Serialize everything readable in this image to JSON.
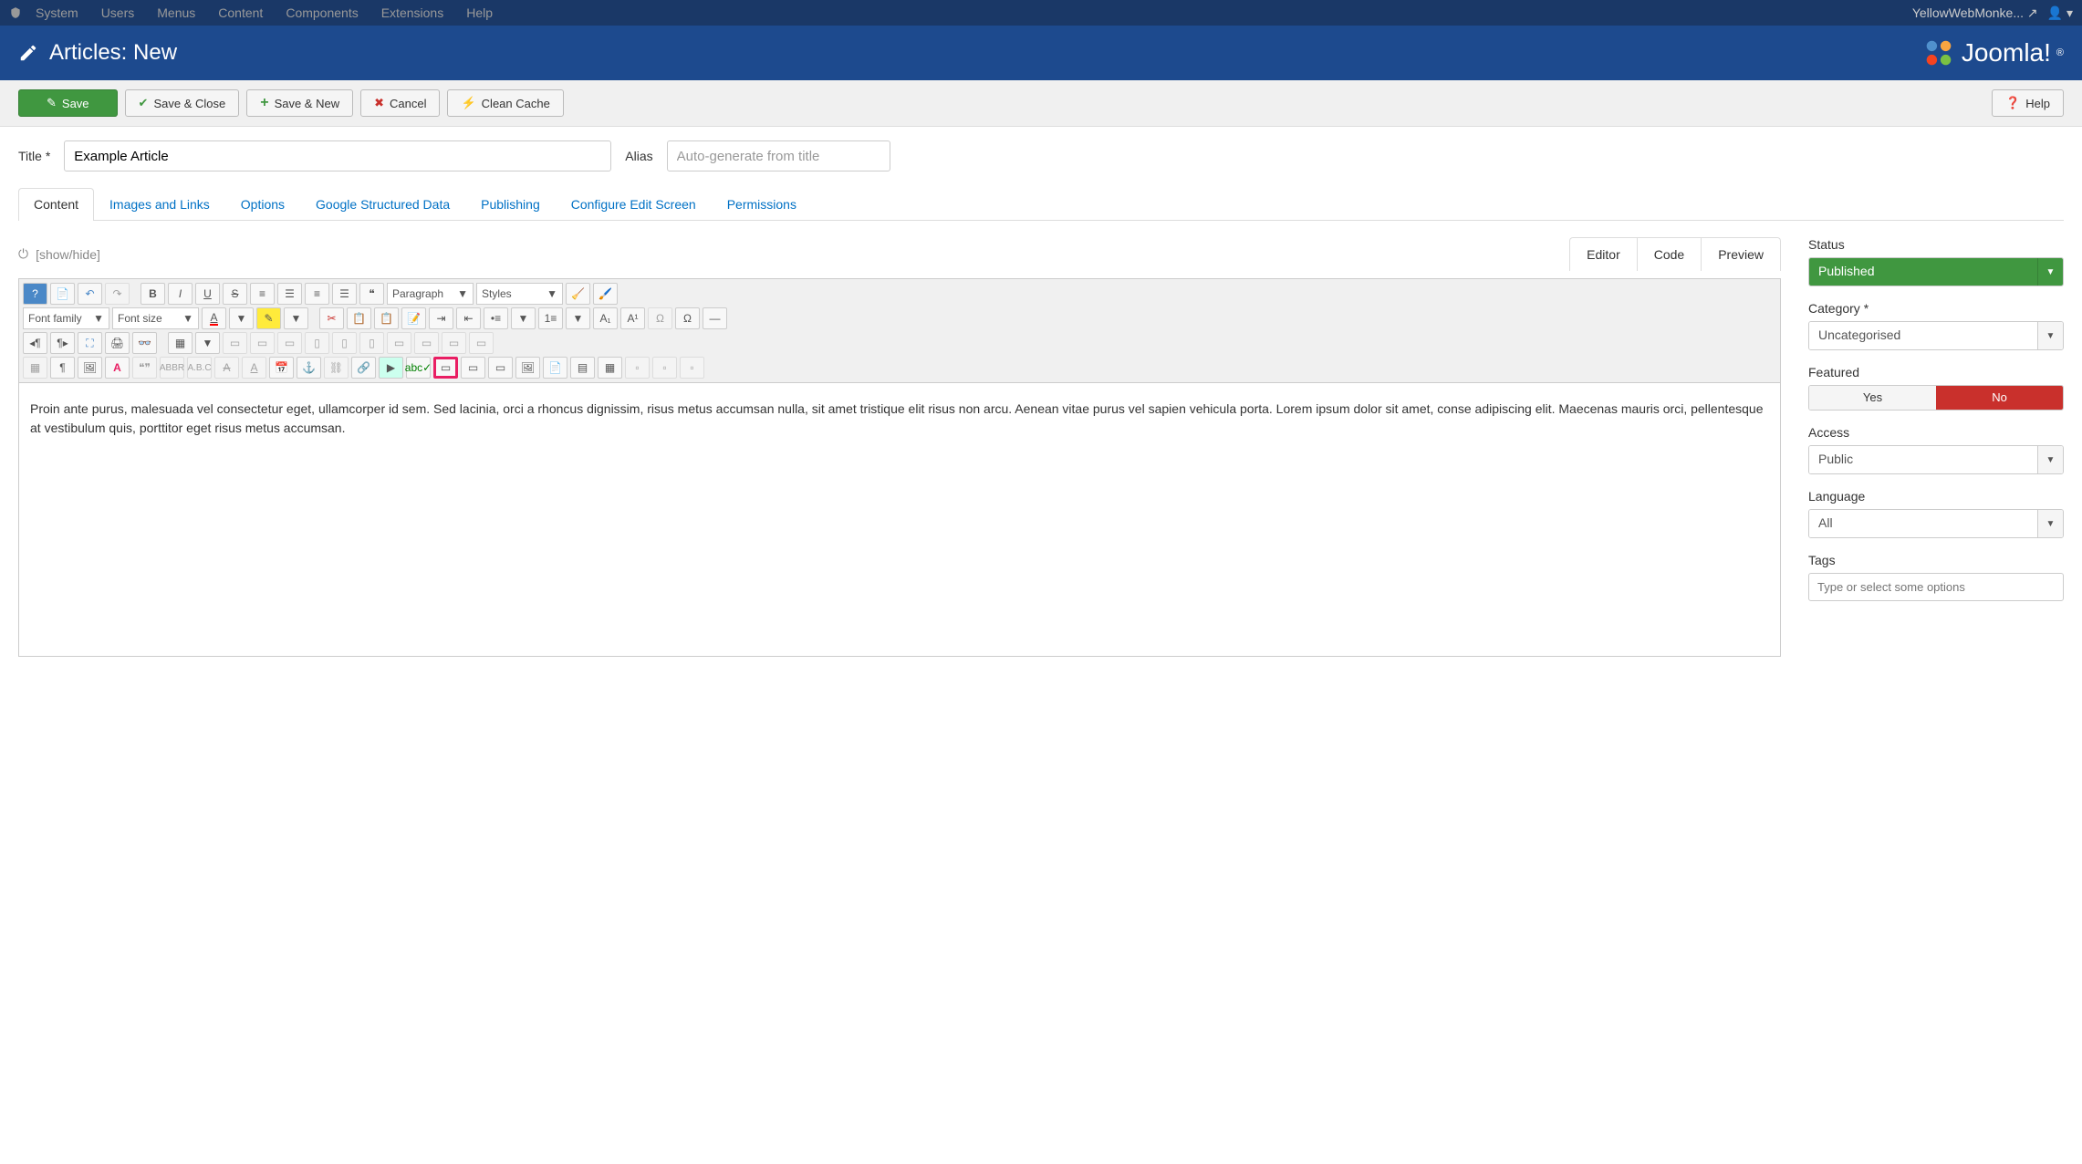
{
  "topmenu": {
    "items": [
      "System",
      "Users",
      "Menus",
      "Content",
      "Components",
      "Extensions",
      "Help"
    ],
    "user": "YellowWebMonke..."
  },
  "header": {
    "title": "Articles: New",
    "logo": "Joomla!"
  },
  "toolbar": {
    "save": "Save",
    "save_close": "Save & Close",
    "save_new": "Save & New",
    "cancel": "Cancel",
    "clean_cache": "Clean Cache",
    "help": "Help"
  },
  "title_row": {
    "title_label": "Title *",
    "title_value": "Example Article",
    "alias_label": "Alias",
    "alias_placeholder": "Auto-generate from title"
  },
  "tabs": [
    "Content",
    "Images and Links",
    "Options",
    "Google Structured Data",
    "Publishing",
    "Configure Edit Screen",
    "Permissions"
  ],
  "editor_head": {
    "showhide": "[show/hide]",
    "subtabs": [
      "Editor",
      "Code",
      "Preview"
    ]
  },
  "editor_tb": {
    "paragraph": "Paragraph",
    "styles": "Styles",
    "font_family": "Font family",
    "font_size": "Font size"
  },
  "editor_content": "Proin ante purus, malesuada vel consectetur eget, ullamcorper id sem. Sed lacinia, orci a rhoncus dignissim, risus metus accumsan nulla, sit amet tristique elit risus non arcu. Aenean vitae purus vel sapien vehicula porta. Lorem ipsum dolor sit amet, conse adipiscing elit. Maecenas mauris orci, pellentesque at vestibulum quis, porttitor eget risus metus accumsan.",
  "sidebar": {
    "status_label": "Status",
    "status_value": "Published",
    "category_label": "Category *",
    "category_value": "Uncategorised",
    "featured_label": "Featured",
    "featured_yes": "Yes",
    "featured_no": "No",
    "access_label": "Access",
    "access_value": "Public",
    "language_label": "Language",
    "language_value": "All",
    "tags_label": "Tags",
    "tags_placeholder": "Type or select some options"
  }
}
